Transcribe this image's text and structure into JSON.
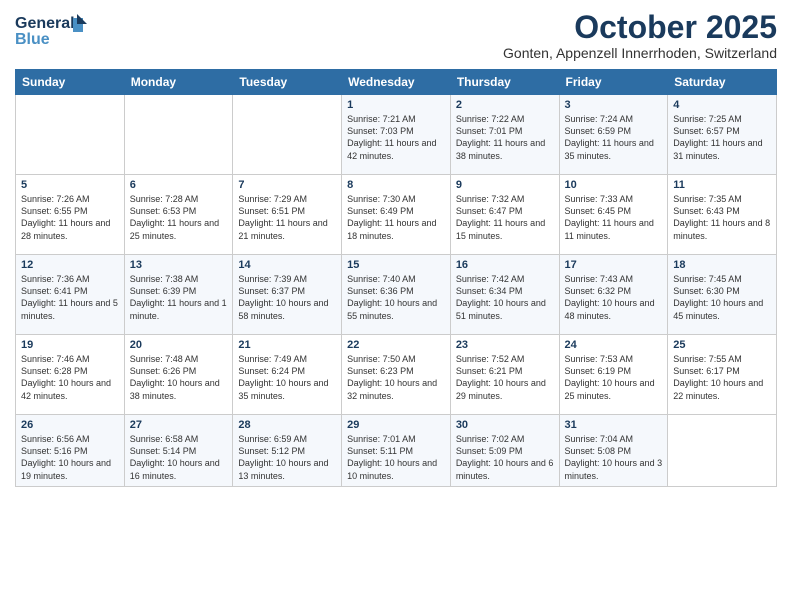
{
  "header": {
    "logo_general": "General",
    "logo_blue": "Blue",
    "month": "October 2025",
    "location": "Gonten, Appenzell Innerrhoden, Switzerland"
  },
  "days_of_week": [
    "Sunday",
    "Monday",
    "Tuesday",
    "Wednesday",
    "Thursday",
    "Friday",
    "Saturday"
  ],
  "weeks": [
    [
      {
        "day": "",
        "content": ""
      },
      {
        "day": "",
        "content": ""
      },
      {
        "day": "",
        "content": ""
      },
      {
        "day": "1",
        "content": "Sunrise: 7:21 AM\nSunset: 7:03 PM\nDaylight: 11 hours and 42 minutes."
      },
      {
        "day": "2",
        "content": "Sunrise: 7:22 AM\nSunset: 7:01 PM\nDaylight: 11 hours and 38 minutes."
      },
      {
        "day": "3",
        "content": "Sunrise: 7:24 AM\nSunset: 6:59 PM\nDaylight: 11 hours and 35 minutes."
      },
      {
        "day": "4",
        "content": "Sunrise: 7:25 AM\nSunset: 6:57 PM\nDaylight: 11 hours and 31 minutes."
      }
    ],
    [
      {
        "day": "5",
        "content": "Sunrise: 7:26 AM\nSunset: 6:55 PM\nDaylight: 11 hours and 28 minutes."
      },
      {
        "day": "6",
        "content": "Sunrise: 7:28 AM\nSunset: 6:53 PM\nDaylight: 11 hours and 25 minutes."
      },
      {
        "day": "7",
        "content": "Sunrise: 7:29 AM\nSunset: 6:51 PM\nDaylight: 11 hours and 21 minutes."
      },
      {
        "day": "8",
        "content": "Sunrise: 7:30 AM\nSunset: 6:49 PM\nDaylight: 11 hours and 18 minutes."
      },
      {
        "day": "9",
        "content": "Sunrise: 7:32 AM\nSunset: 6:47 PM\nDaylight: 11 hours and 15 minutes."
      },
      {
        "day": "10",
        "content": "Sunrise: 7:33 AM\nSunset: 6:45 PM\nDaylight: 11 hours and 11 minutes."
      },
      {
        "day": "11",
        "content": "Sunrise: 7:35 AM\nSunset: 6:43 PM\nDaylight: 11 hours and 8 minutes."
      }
    ],
    [
      {
        "day": "12",
        "content": "Sunrise: 7:36 AM\nSunset: 6:41 PM\nDaylight: 11 hours and 5 minutes."
      },
      {
        "day": "13",
        "content": "Sunrise: 7:38 AM\nSunset: 6:39 PM\nDaylight: 11 hours and 1 minute."
      },
      {
        "day": "14",
        "content": "Sunrise: 7:39 AM\nSunset: 6:37 PM\nDaylight: 10 hours and 58 minutes."
      },
      {
        "day": "15",
        "content": "Sunrise: 7:40 AM\nSunset: 6:36 PM\nDaylight: 10 hours and 55 minutes."
      },
      {
        "day": "16",
        "content": "Sunrise: 7:42 AM\nSunset: 6:34 PM\nDaylight: 10 hours and 51 minutes."
      },
      {
        "day": "17",
        "content": "Sunrise: 7:43 AM\nSunset: 6:32 PM\nDaylight: 10 hours and 48 minutes."
      },
      {
        "day": "18",
        "content": "Sunrise: 7:45 AM\nSunset: 6:30 PM\nDaylight: 10 hours and 45 minutes."
      }
    ],
    [
      {
        "day": "19",
        "content": "Sunrise: 7:46 AM\nSunset: 6:28 PM\nDaylight: 10 hours and 42 minutes."
      },
      {
        "day": "20",
        "content": "Sunrise: 7:48 AM\nSunset: 6:26 PM\nDaylight: 10 hours and 38 minutes."
      },
      {
        "day": "21",
        "content": "Sunrise: 7:49 AM\nSunset: 6:24 PM\nDaylight: 10 hours and 35 minutes."
      },
      {
        "day": "22",
        "content": "Sunrise: 7:50 AM\nSunset: 6:23 PM\nDaylight: 10 hours and 32 minutes."
      },
      {
        "day": "23",
        "content": "Sunrise: 7:52 AM\nSunset: 6:21 PM\nDaylight: 10 hours and 29 minutes."
      },
      {
        "day": "24",
        "content": "Sunrise: 7:53 AM\nSunset: 6:19 PM\nDaylight: 10 hours and 25 minutes."
      },
      {
        "day": "25",
        "content": "Sunrise: 7:55 AM\nSunset: 6:17 PM\nDaylight: 10 hours and 22 minutes."
      }
    ],
    [
      {
        "day": "26",
        "content": "Sunrise: 6:56 AM\nSunset: 5:16 PM\nDaylight: 10 hours and 19 minutes."
      },
      {
        "day": "27",
        "content": "Sunrise: 6:58 AM\nSunset: 5:14 PM\nDaylight: 10 hours and 16 minutes."
      },
      {
        "day": "28",
        "content": "Sunrise: 6:59 AM\nSunset: 5:12 PM\nDaylight: 10 hours and 13 minutes."
      },
      {
        "day": "29",
        "content": "Sunrise: 7:01 AM\nSunset: 5:11 PM\nDaylight: 10 hours and 10 minutes."
      },
      {
        "day": "30",
        "content": "Sunrise: 7:02 AM\nSunset: 5:09 PM\nDaylight: 10 hours and 6 minutes."
      },
      {
        "day": "31",
        "content": "Sunrise: 7:04 AM\nSunset: 5:08 PM\nDaylight: 10 hours and 3 minutes."
      },
      {
        "day": "",
        "content": ""
      }
    ]
  ]
}
